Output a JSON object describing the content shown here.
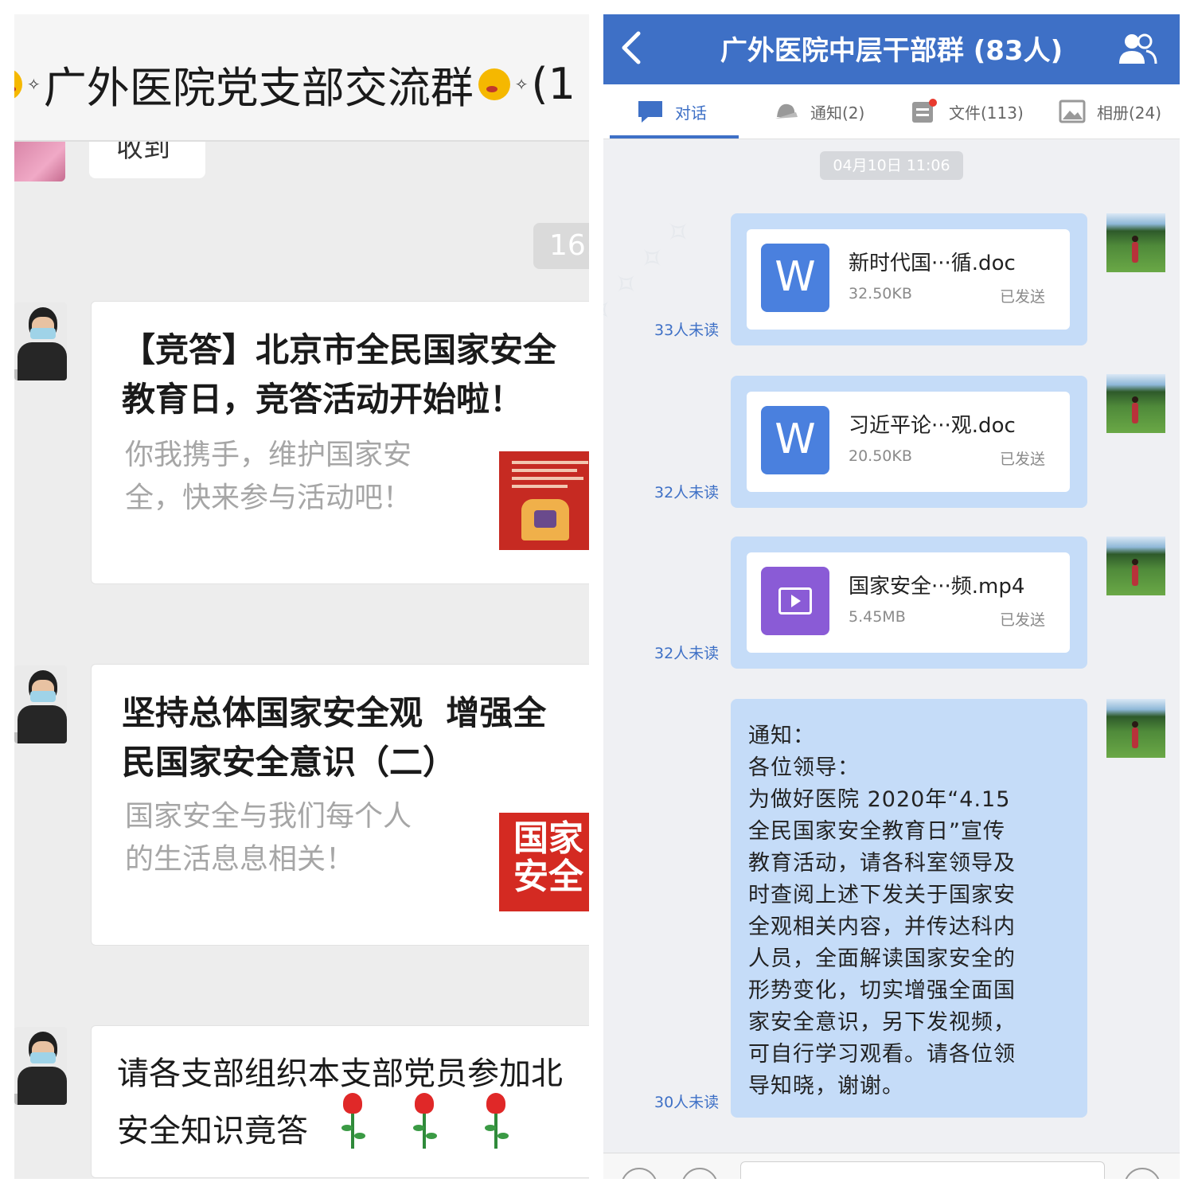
{
  "left_chat": {
    "title": "广外医院党支部交流群",
    "title_suffix": "(1",
    "previous_message": "收到",
    "time_label": "16:",
    "messages": [
      {
        "type": "article",
        "title": "【竞答】北京市全民国家安全教育日，竞答活动开始啦！",
        "description": "你我携手，维护国家安全，快来参与活动吧！"
      },
      {
        "type": "article",
        "title": "坚持总体国家安全观  增强全民国家安全意识（二）",
        "description": "国家安全与我们每个人的生活息息相关！",
        "thumb_lines": [
          "国家",
          "安全"
        ]
      },
      {
        "type": "text",
        "line1": "请各支部组织本支部党员参加北",
        "line2": "安全知识竟答"
      }
    ]
  },
  "right_chat": {
    "title": "广外医院中层干部群 (83人)",
    "tabs": [
      {
        "label": "对话",
        "icon": "chat-icon",
        "active": true
      },
      {
        "label": "通知(2)",
        "icon": "bell-icon",
        "active": false
      },
      {
        "label": "文件(113)",
        "icon": "file-icon",
        "active": false
      },
      {
        "label": "相册(24)",
        "icon": "photo-icon",
        "active": false
      }
    ],
    "date_label": "04月10日 11:06",
    "files": [
      {
        "name": "新时代国···循.doc",
        "size": "32.50KB",
        "status": "已发送",
        "unread": "33人未读",
        "icon": "word-icon",
        "icon_letter": "W"
      },
      {
        "name": "习近平论···观.doc",
        "size": "20.50KB",
        "status": "已发送",
        "unread": "32人未读",
        "icon": "word-icon",
        "icon_letter": "W"
      },
      {
        "name": "国家安全···频.mp4",
        "size": "5.45MB",
        "status": "已发送",
        "unread": "32人未读",
        "icon": "video-icon"
      }
    ],
    "notice": {
      "unread": "30人未读",
      "lines": [
        "通知：",
        "各位领导：",
        "为做好医院 2020年“4.15",
        "全民国家安全教育日”宣传",
        "教育活动，请各科室领导及",
        "时查阅上述下发关于国家安",
        "全观相关内容，并传达科内",
        "人员，全面解读国家安全的",
        "形势变化，切实增强全面国",
        "家安全意识，另下发视频，",
        "可自行学习观看。请各位领",
        "导知晓，谢谢。"
      ]
    },
    "colors": {
      "header": "#3e70c6",
      "bubble": "#c5dcf8",
      "unread": "#3e70c6"
    }
  }
}
